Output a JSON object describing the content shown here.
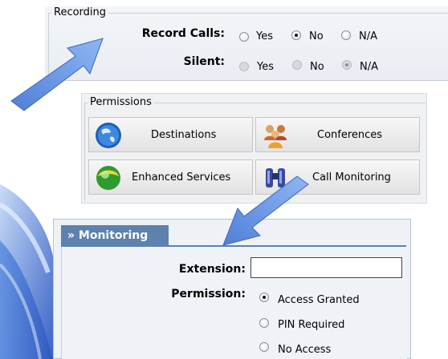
{
  "recording": {
    "legend": "Recording",
    "record_calls": {
      "label": "Record Calls:",
      "options": [
        "Yes",
        "No",
        "N/A"
      ],
      "selected": "No"
    },
    "silent": {
      "label": "Silent:",
      "options": [
        "Yes",
        "No",
        "N/A"
      ],
      "selected": "N/A",
      "disabled": true
    }
  },
  "permissions": {
    "legend": "Permissions",
    "buttons": [
      {
        "label": "Destinations",
        "icon": "globe-icon"
      },
      {
        "label": "Conferences",
        "icon": "people-icon"
      },
      {
        "label": "Enhanced Services",
        "icon": "services-orb-icon"
      },
      {
        "label": "Call Monitoring",
        "icon": "binoculars-icon"
      }
    ]
  },
  "monitoring": {
    "tab_label": "» Monitoring",
    "extension_label": "Extension:",
    "extension_value": "",
    "permission_label": "Permission:",
    "permission_options": [
      "Access Granted",
      "PIN Required",
      "No Access"
    ],
    "permission_selected": "Access Granted"
  },
  "colors": {
    "tab_blue": "#5c82ad",
    "arrow_blue": "#6c98e3"
  }
}
